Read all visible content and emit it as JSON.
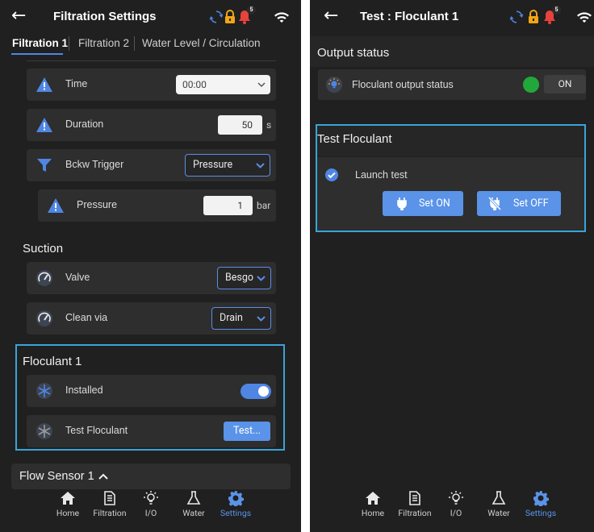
{
  "colors": {
    "accent": "#5a93e8",
    "highlight": "#38a4d9",
    "bg": "#202020",
    "row": "#2e2e2e",
    "ok_green": "#22a83a",
    "lock": "#f2a516",
    "bell": "#e8423c"
  },
  "status_icons": {
    "sync": "sync-icon",
    "lock": "lock-icon",
    "bell": "bell-icon",
    "bell_badge": "5",
    "wifi": "wifi-icon"
  },
  "left": {
    "title": "Filtration Settings",
    "tabs": [
      "Filtration 1",
      "Filtration 2",
      "Water Level / Circulation"
    ],
    "rows": {
      "time": {
        "label": "Time",
        "value": "00:00"
      },
      "duration": {
        "label": "Duration",
        "value": "50",
        "unit": "s"
      },
      "bckw_trigger": {
        "label": "Bckw Trigger",
        "value": "Pressure"
      },
      "pressure": {
        "label": "Pressure",
        "value": "1",
        "unit": "bar"
      }
    },
    "suction": {
      "title": "Suction",
      "valve": {
        "label": "Valve",
        "value": "Besgo"
      },
      "clean_via": {
        "label": "Clean via",
        "value": "Drain"
      }
    },
    "floculant": {
      "title": "Floculant 1",
      "installed": {
        "label": "Installed",
        "on": true
      },
      "test": {
        "label": "Test Floculant",
        "button": "Test..."
      }
    },
    "flow_sensor": {
      "title": "Flow Sensor 1"
    }
  },
  "right": {
    "title": "Test : Floculant 1",
    "output_status": {
      "title": "Output status",
      "label": "Floculant output status",
      "state": "ON"
    },
    "test_floculant": {
      "title": "Test Floculant",
      "launch": "Launch test",
      "set_on": "Set ON",
      "set_off": "Set OFF"
    }
  },
  "nav": [
    "Home",
    "Filtration",
    "I/O",
    "Water",
    "Settings"
  ]
}
